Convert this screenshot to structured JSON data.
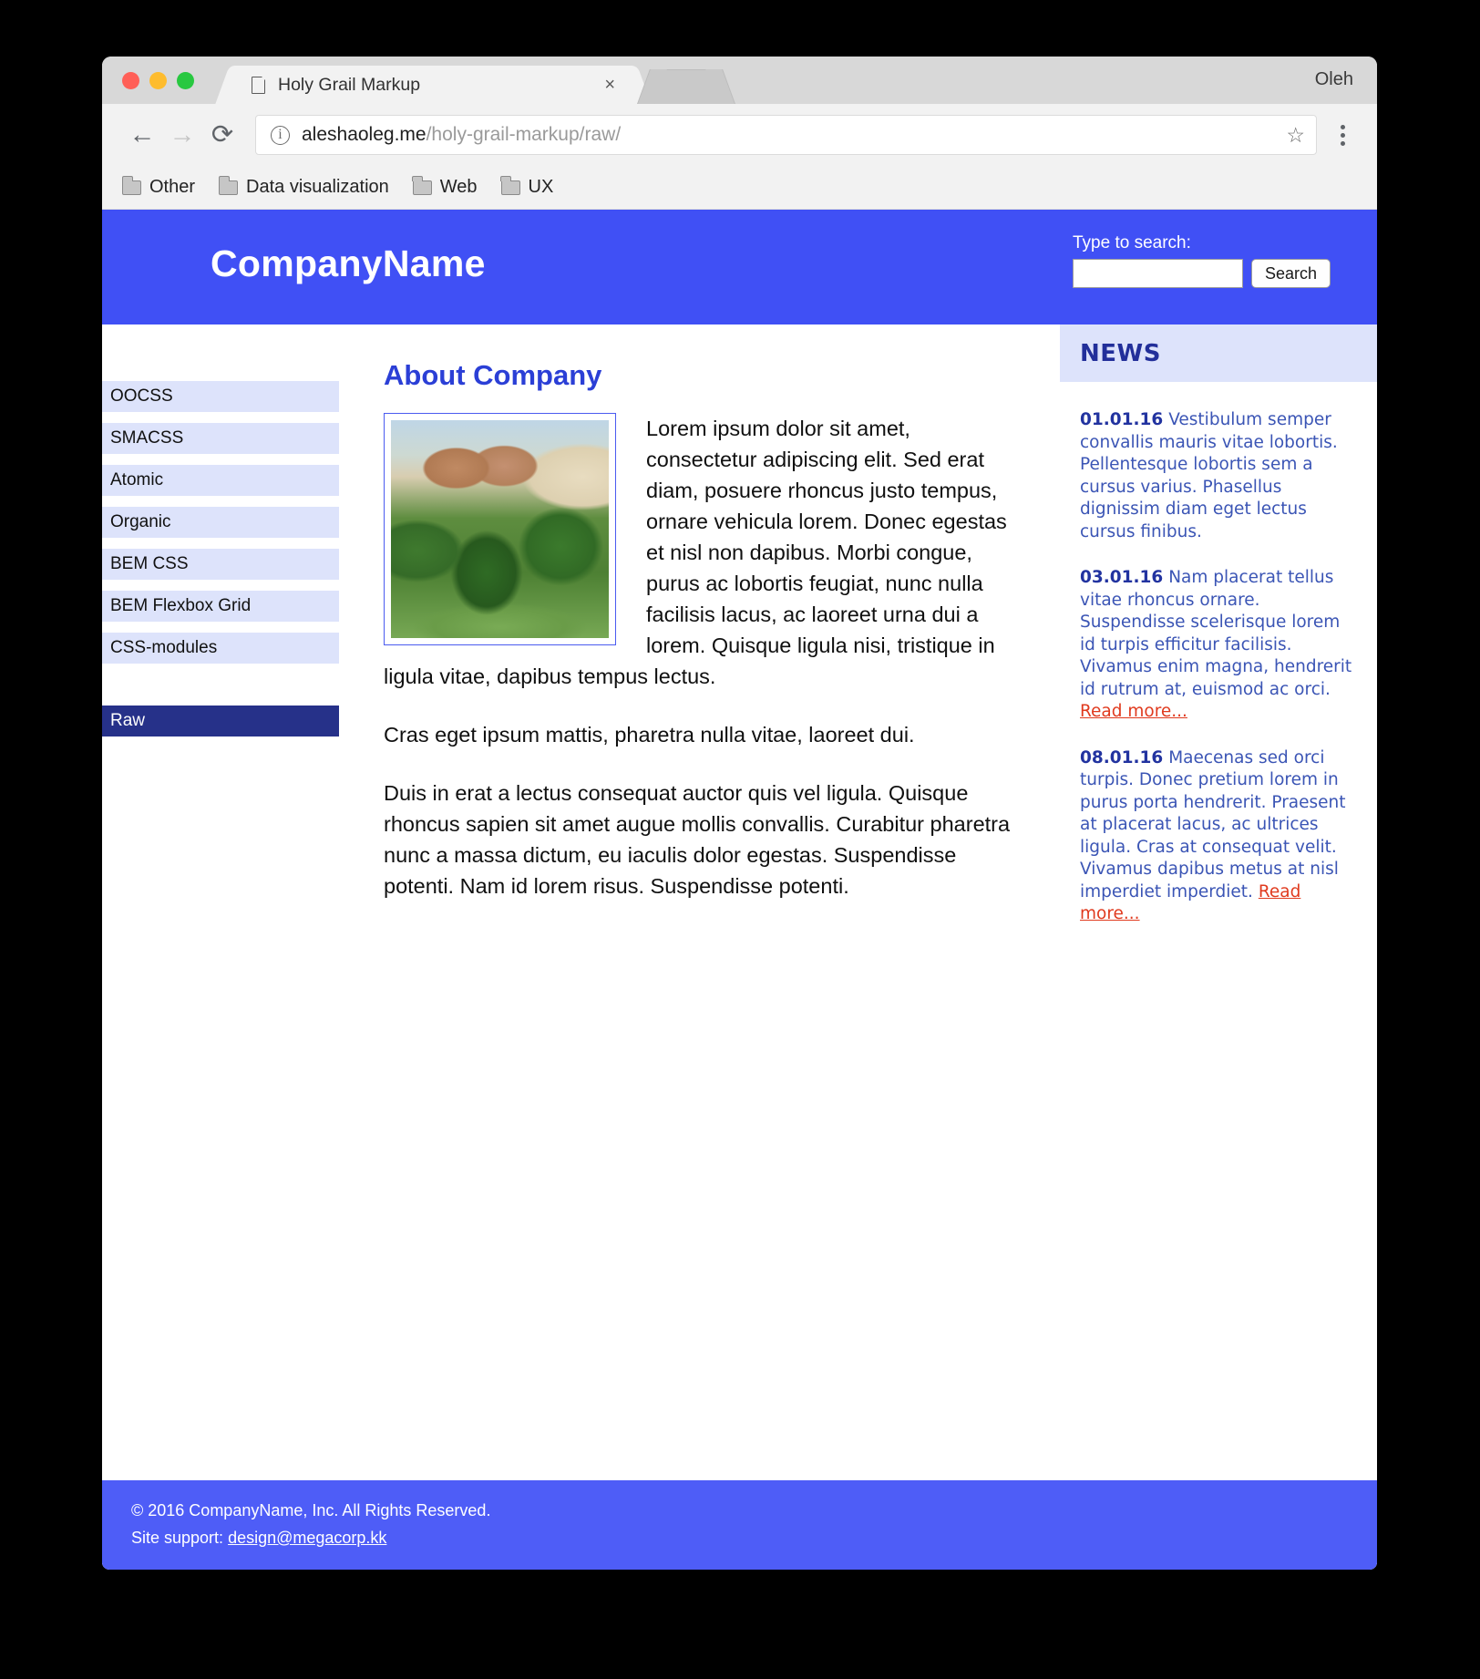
{
  "browser": {
    "profile_name": "Oleh",
    "tab": {
      "title": "Holy Grail Markup",
      "close_label": "×",
      "doc_icon": "document-icon"
    },
    "nav": {
      "back": "←",
      "forward": "→",
      "reload": "⟳"
    },
    "omnibox": {
      "info_icon": "info-icon",
      "url_domain": "aleshaoleg.me",
      "url_path": "/holy-grail-markup/raw/",
      "star_icon": "☆"
    },
    "bookmarks": [
      {
        "label": "Other"
      },
      {
        "label": "Data visualization"
      },
      {
        "label": "Web"
      },
      {
        "label": "UX"
      }
    ]
  },
  "site": {
    "header": {
      "company_name": "CompanyName",
      "search_label": "Type to search:",
      "search_value": "",
      "search_placeholder": "",
      "search_button": "Search"
    },
    "sidebar": {
      "items": [
        {
          "label": "OOCSS",
          "active": false
        },
        {
          "label": "SMACSS",
          "active": false
        },
        {
          "label": "Atomic",
          "active": false
        },
        {
          "label": "Organic",
          "active": false
        },
        {
          "label": "BEM CSS",
          "active": false
        },
        {
          "label": "BEM Flexbox Grid",
          "active": false
        },
        {
          "label": "CSS-modules",
          "active": false
        },
        {
          "label": "Raw",
          "active": true
        }
      ]
    },
    "article": {
      "title": "About Company",
      "image_alt": "desert-resort-building-with-palm-trees-photo",
      "paragraphs": [
        "Lorem ipsum dolor sit amet, consectetur adipiscing elit. Sed erat diam, posuere rhoncus justo tempus, ornare vehicula lorem. Donec egestas et nisl non dapibus. Morbi congue, purus ac lobortis feugiat, nunc nulla facilisis lacus, ac laoreet urna dui a lorem. Quisque ligula nisi, tristique in ligula vitae, dapibus tempus lectus.",
        "Cras eget ipsum mattis, pharetra nulla vitae, laoreet dui.",
        "Duis in erat a lectus consequat auctor quis vel ligula. Quisque rhoncus sapien sit amet augue mollis convallis. Curabitur pharetra nunc a massa dictum, eu iaculis dolor egestas. Suspendisse potenti. Nam id lorem risus. Suspendisse potenti."
      ]
    },
    "news": {
      "title": "NEWS",
      "read_more_label": "Read more...",
      "items": [
        {
          "date": "01.01.16",
          "text": "Vestibulum semper convallis mauris vitae lobortis. Pellentesque lobortis sem a cursus varius. Phasellus dignissim diam eget lectus cursus finibus.",
          "has_read_more": false
        },
        {
          "date": "03.01.16",
          "text": "Nam placerat tellus vitae rhoncus ornare. Suspendisse scelerisque lorem id turpis efficitur facilisis. Vivamus enim magna, hendrerit id rutrum at, euismod ac orci.",
          "has_read_more": true
        },
        {
          "date": "08.01.16",
          "text": "Maecenas sed orci turpis. Donec pretium lorem in purus porta hendrerit. Praesent at placerat lacus, ac ultrices ligula. Cras at consequat velit. Vivamus dapibus metus at nisl imperdiet imperdiet.",
          "has_read_more": true
        }
      ]
    },
    "footer": {
      "copyright": "© 2016 CompanyName, Inc. All Rights Reserved.",
      "support_prefix": "Site support: ",
      "support_email": "design@megacorp.kk"
    }
  },
  "colors": {
    "brand_blue": "#4050F5",
    "nav_item_bg": "#DDE3FB",
    "nav_active_bg": "#263189",
    "heading_blue": "#2B3FD6",
    "news_text": "#3B55B5",
    "read_more_red": "#E03A1E",
    "footer_blue": "#4E5DF7"
  }
}
